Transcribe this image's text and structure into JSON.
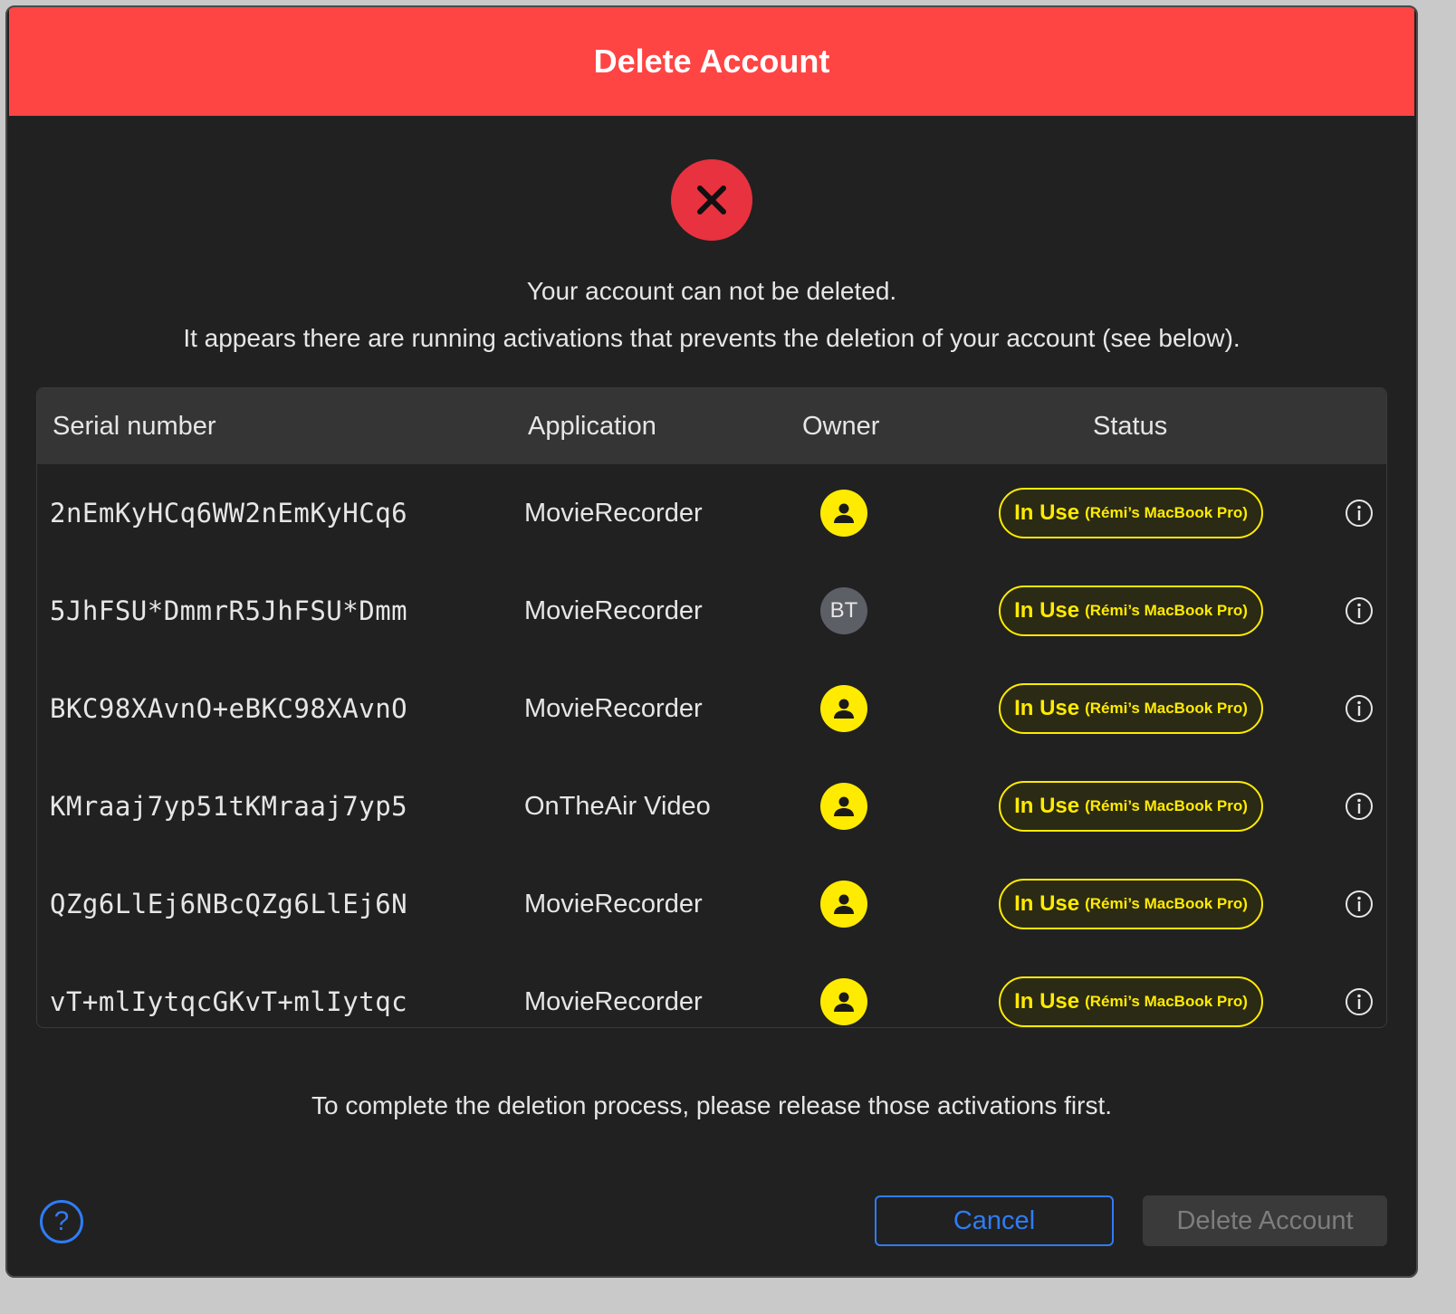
{
  "dialog": {
    "title": "Delete Account",
    "message_primary": "Your account can not be deleted.",
    "message_secondary": "It appears there are running activations that prevents the deletion of your account (see below).",
    "footer_message": "To complete the deletion process, please release those activations first."
  },
  "colors": {
    "title_bar": "#ff4444",
    "error_icon": "#e8323f",
    "badge": "#ffeb00",
    "accent": "#2f7cf6"
  },
  "table": {
    "headers": {
      "serial": "Serial number",
      "application": "Application",
      "owner": "Owner",
      "status": "Status"
    },
    "rows": [
      {
        "serial": "2nEmKyHCq6WW2nEmKyHCq6",
        "application": "MovieRecorder",
        "owner": "person-icon",
        "status": "In Use",
        "status_detail": "(Rémi’s MacBook Pro)"
      },
      {
        "serial": "5JhFSU*DmmrR5JhFSU*Dmm",
        "application": "MovieRecorder",
        "owner_initials": "BT",
        "status": "In Use",
        "status_detail": "(Rémi’s MacBook Pro)"
      },
      {
        "serial": "BKC98XAvnO+eBKC98XAvnO",
        "application": "MovieRecorder",
        "owner": "person-icon",
        "status": "In Use",
        "status_detail": "(Rémi’s MacBook Pro)"
      },
      {
        "serial": "KMraaj7yp51tKMraaj7yp5",
        "application": "OnTheAir Video",
        "owner": "person-icon",
        "status": "In Use",
        "status_detail": "(Rémi’s MacBook Pro)"
      },
      {
        "serial": "QZg6LlEj6NBcQZg6LlEj6N",
        "application": "MovieRecorder",
        "owner": "person-icon",
        "status": "In Use",
        "status_detail": "(Rémi’s MacBook Pro)"
      },
      {
        "serial": "vT+mlIytqcGKvT+mlIytqc",
        "application": "MovieRecorder",
        "owner": "person-icon",
        "status": "In Use",
        "status_detail": "(Rémi’s MacBook Pro)"
      }
    ]
  },
  "buttons": {
    "help": "?",
    "cancel": "Cancel",
    "delete": "Delete Account"
  }
}
